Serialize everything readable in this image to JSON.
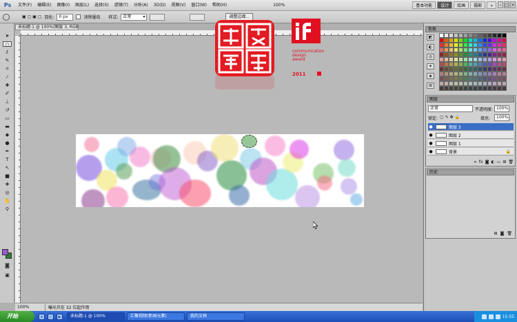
{
  "menubar": {
    "logo": "Ps",
    "items": [
      "文件(F)",
      "编辑(E)",
      "图像(I)",
      "图层(L)",
      "选择(S)",
      "滤镜(T)",
      "分析(A)",
      "3D(D)",
      "视图(V)",
      "窗口(W)",
      "帮助(H)"
    ],
    "zoom": "100%",
    "workspaces": [
      "基本功能",
      "设计",
      "绘画",
      "摄影"
    ],
    "active_workspace": "设计",
    "more": "»",
    "window_controls": [
      "–",
      "□",
      "×"
    ]
  },
  "optionsbar": {
    "feather_label": "羽化:",
    "feather_value": "0 px",
    "antialias_label": "消除锯齿",
    "style_label": "样式:",
    "style_value": "正常",
    "refine_edge": "调整边缘..."
  },
  "document": {
    "tab_title": "未标题-1 @ 100%(图层 3, RGB/8)",
    "zoom": "100%",
    "status": "曝光只在 32 位起作用"
  },
  "logos": {
    "if_mark": "iF",
    "if_text": "communication\ndesign\naward",
    "if_year": "2011"
  },
  "panels": {
    "swatches_tab": "色板",
    "layers_tab": "图层",
    "blend_mode": "正常",
    "opacity_label": "不透明度:",
    "opacity": "100%",
    "lock_label": "锁定:",
    "fill_label": "填充:",
    "fill": "100%",
    "layers": [
      {
        "name": "图层 3",
        "selected": true
      },
      {
        "name": "图层 2",
        "selected": false
      },
      {
        "name": "图层 1",
        "selected": false
      },
      {
        "name": "背景",
        "selected": false
      }
    ],
    "history_tab": "历史"
  },
  "taskbar": {
    "start": "开始",
    "tasks": [
      "未标题-1 @ 100%",
      "汇聚视频(新闻元素)",
      "我的文档"
    ],
    "clock": "15:55"
  },
  "colors": {
    "selected_layer": "#3a6ec6",
    "foreground": "#9b59d0",
    "background": "#2e7d32",
    "brand_red": "#e01020"
  }
}
